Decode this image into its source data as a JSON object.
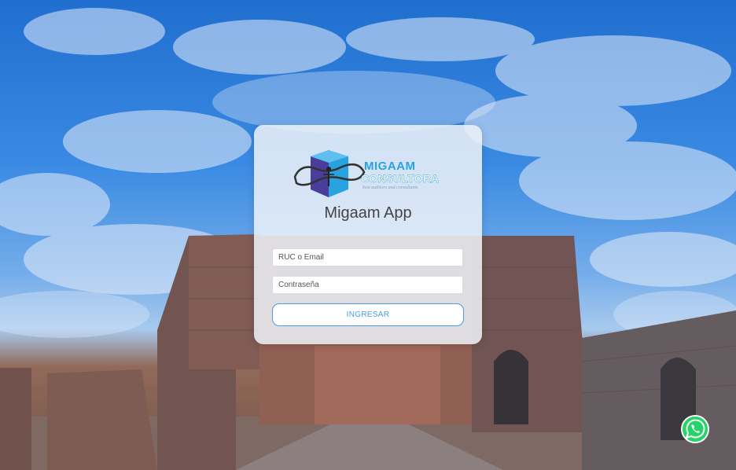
{
  "background": {
    "scene": "ruins-sky-photo"
  },
  "login": {
    "logo_brand": "MIGAAM",
    "logo_sub": "CONSULTORA",
    "logo_tagline": "best auditors and consultants",
    "app_title": "Migaam App",
    "user_placeholder": "RUC o Email",
    "password_placeholder": "Contraseña",
    "submit_label": "INGRESAR"
  },
  "colors": {
    "accent": "#4a9be0",
    "brand_blue": "#29a3e0",
    "brand_purple": "#4b3e9a",
    "whatsapp": "#25d366"
  },
  "whatsapp": {
    "icon": "whatsapp-icon"
  }
}
